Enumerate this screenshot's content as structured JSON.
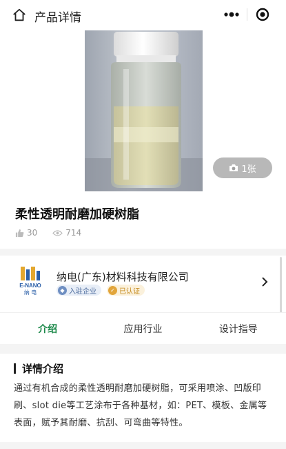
{
  "header": {
    "title": "产品详情"
  },
  "gallery": {
    "photo_count": "1张"
  },
  "product": {
    "title": "柔性透明耐磨加硬树脂",
    "likes": "30",
    "views": "714"
  },
  "company": {
    "name": "纳电(广东)材料科技有限公司",
    "logo_text": "E-NANO",
    "logo_subtext": "纳 电",
    "badge_enter": "入驻企业",
    "badge_cert": "已认证"
  },
  "tabs": [
    {
      "label": "介绍",
      "active": true
    },
    {
      "label": "应用行业",
      "active": false
    },
    {
      "label": "设计指导",
      "active": false
    }
  ],
  "details": {
    "heading": "详情介绍",
    "text": "通过有机合成的柔性透明耐磨加硬树脂，可采用喷涂、凹版印刷、slot die等工艺涂布于各种基材，如：PET、模板、金属等表面，赋予其耐磨、抗刮、可弯曲等特性。"
  },
  "colors": {
    "accent": "#1f8a4c",
    "cert": "#e2a53a",
    "enter": "#6f8fc2"
  },
  "icons": [
    "home-icon",
    "more-icon",
    "target-icon",
    "camera-icon",
    "thumbs-up-icon",
    "eye-icon",
    "chevron-right-icon"
  ]
}
